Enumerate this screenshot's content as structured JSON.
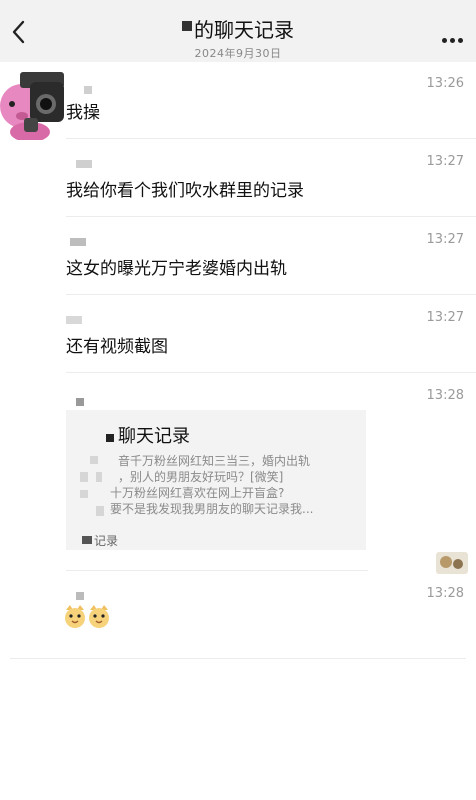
{
  "header": {
    "title": "的聊天记录",
    "date": "2024年9月30日"
  },
  "messages": [
    {
      "time": "13:26",
      "text": "我操"
    },
    {
      "time": "13:27",
      "text": "我给你看个我们吹水群里的记录"
    },
    {
      "time": "13:27",
      "text": "这女的曝光万宁老婆婚内出轨"
    },
    {
      "time": "13:27",
      "text": "还有视频截图"
    },
    {
      "time": "13:28"
    },
    {
      "time": "13:28"
    }
  ],
  "card": {
    "title": "聊天记录",
    "lines": [
      "音千万粉丝网红知三当三，婚内出轨",
      "，别人的男朋友好玩吗？[微笑]",
      "十万粉丝网红喜欢在网上开盲盒?",
      "要不是我发现我男朋友的聊天记录我..."
    ],
    "footer": "记录"
  },
  "icons": {
    "back": "chevron-left-icon",
    "more": "more-dots-icon",
    "sticker": "pig-gun-sticker",
    "emoji": "cat-face-emoji"
  }
}
